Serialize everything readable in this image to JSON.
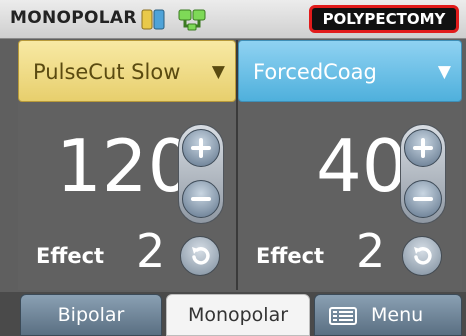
{
  "status_bar": {
    "mode": "MONOPOLAR",
    "pad_icons": [
      "electrode-pads-icon",
      "return-electrode-icon"
    ],
    "program": "POLYPECTOMY"
  },
  "channels": [
    {
      "mode_label": "PulseCut Slow",
      "value": "120",
      "effect_label": "Effect",
      "effect_value": "2",
      "color": "#e7cf6d"
    },
    {
      "mode_label": "ForcedCoag",
      "value": "40",
      "effect_label": "Effect",
      "effect_value": "2",
      "color": "#4fb0dc"
    }
  ],
  "tabs": {
    "bipolar": "Bipolar",
    "monopolar": "Monopolar",
    "menu": "Menu"
  },
  "colors": {
    "program_border": "#e11b1b",
    "background": "#5f5f5f"
  }
}
